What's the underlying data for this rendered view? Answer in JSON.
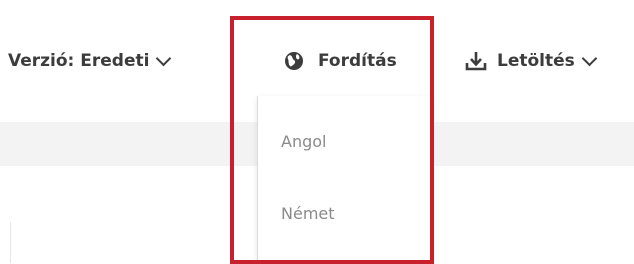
{
  "toolbar": {
    "version": {
      "label": "Verzió: Eredeti",
      "icon": "chevron-down-icon"
    },
    "translate": {
      "label": "Fordítás",
      "icon": "globe-icon"
    },
    "download": {
      "label": "Letöltés",
      "icon": "download-icon"
    }
  },
  "translate_menu": {
    "items": [
      {
        "label": "Angol"
      },
      {
        "label": "Német"
      }
    ]
  },
  "colors": {
    "text": "#3c3c3c",
    "menu_text": "#8a8a8a",
    "subbar_bg": "#f3f3f3",
    "highlight": "#c8202c"
  }
}
